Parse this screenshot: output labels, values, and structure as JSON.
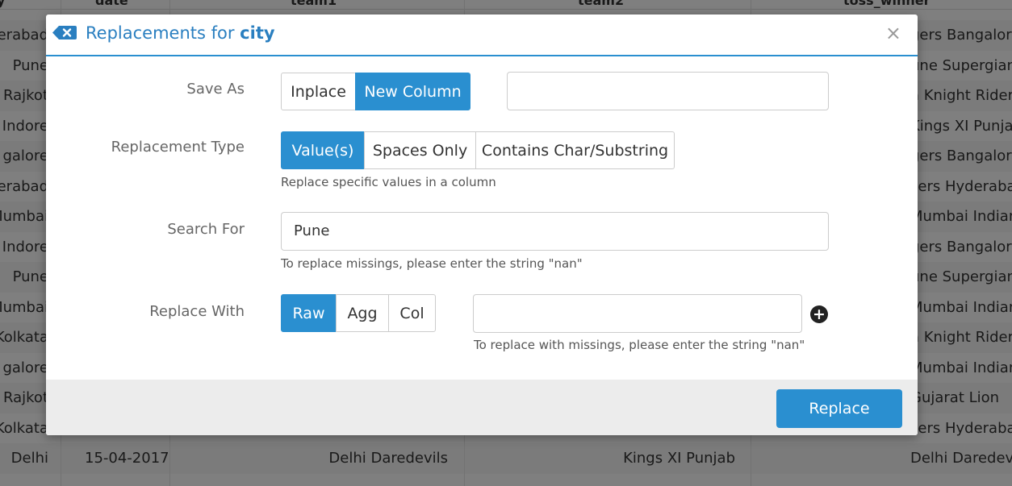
{
  "background_table": {
    "headers": [
      "y",
      "date",
      "team1",
      "team2",
      "toss_winner"
    ],
    "rows": [
      [
        "erabad",
        "",
        "",
        "",
        "gers Bangalore"
      ],
      [
        "Pune",
        "",
        "",
        "",
        "une Supergian"
      ],
      [
        "Rajkot",
        "",
        "",
        "",
        "a Knight Rider"
      ],
      [
        "Indore",
        "",
        "",
        "",
        "Kings XI Punja"
      ],
      [
        "galore",
        "",
        "",
        "",
        "gers Bangalore"
      ],
      [
        "erabad",
        "",
        "",
        "",
        "sers Hyderaba"
      ],
      [
        "Mumbai",
        "",
        "",
        "",
        "Mumbai Indian"
      ],
      [
        "Indore",
        "",
        "",
        "",
        "gers Bangalore"
      ],
      [
        "Pune",
        "",
        "",
        "",
        "une Supergian"
      ],
      [
        "Mumbai",
        "",
        "",
        "",
        "Mumbai Indian"
      ],
      [
        "Kolkata",
        "",
        "",
        "",
        "a Knight Rider"
      ],
      [
        "galore",
        "",
        "",
        "",
        "Mumbai Indian"
      ],
      [
        "Rajkot",
        "",
        "",
        "",
        "Gujarat Lion"
      ],
      [
        "Kolkata",
        "",
        "",
        "",
        "sers Hyderaba"
      ],
      [
        "Delhi",
        "15-04-2017",
        "Delhi Daredevils",
        "Kings XI Punjab",
        "Delhi Daredevils"
      ],
      [
        "",
        "",
        "",
        "",
        ""
      ]
    ]
  },
  "modal": {
    "title_prefix": "Replacements for",
    "title_column": "city",
    "close_glyph": "×",
    "icon": "backspace-icon",
    "save_as": {
      "label": "Save As",
      "options": [
        "Inplace",
        "New Column"
      ],
      "selected": "New Column",
      "column_name_value": ""
    },
    "replacement_type": {
      "label": "Replacement Type",
      "options": [
        "Value(s)",
        "Spaces Only",
        "Contains Char/Substring"
      ],
      "selected": "Value(s)",
      "help": "Replace specific values in a column"
    },
    "search_for": {
      "label": "Search For",
      "value": "Pune",
      "help": "To replace missings, please enter the string \"nan\""
    },
    "replace_with": {
      "label": "Replace With",
      "options": [
        "Raw",
        "Agg",
        "Col"
      ],
      "selected": "Raw",
      "value": "",
      "help": "To replace with missings, please enter the string \"nan\"",
      "add_icon": "plus-circle-icon"
    },
    "footer": {
      "replace_label": "Replace"
    }
  },
  "colors": {
    "accent": "#2a8fd0",
    "title": "#2a7fc0",
    "overlay": "rgba(0,0,0,0.5)"
  }
}
